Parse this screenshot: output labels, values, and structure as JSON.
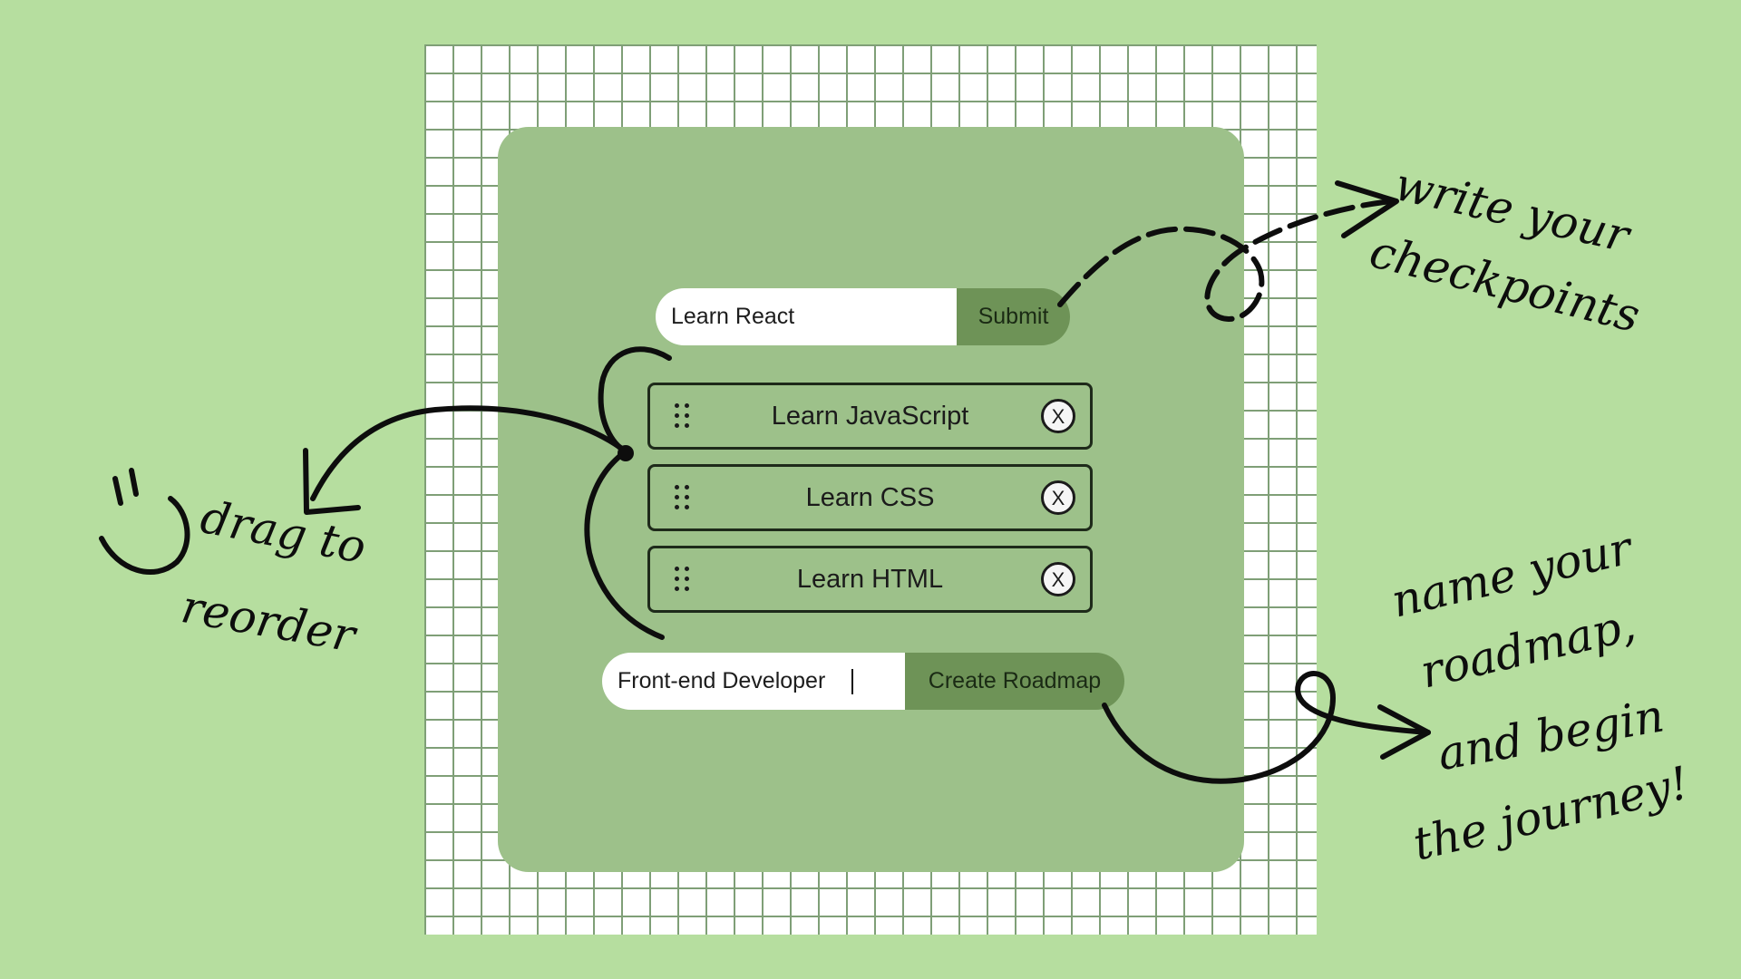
{
  "checkpoint_form": {
    "input_value": "Learn React",
    "submit_label": "Submit"
  },
  "checkpoints": [
    {
      "label": "Learn JavaScript",
      "remove_label": "X"
    },
    {
      "label": "Learn CSS",
      "remove_label": "X"
    },
    {
      "label": "Learn HTML",
      "remove_label": "X"
    }
  ],
  "roadmap_form": {
    "input_value": "Front-end Developer",
    "create_label": "Create Roadmap"
  },
  "annotations": {
    "write_line1": "write your",
    "write_line2": "checkpoints",
    "drag_line1": "drag to",
    "drag_line2": "reorder",
    "name_line1": "name your",
    "name_line2": "roadmap,",
    "name_line3": "and begin",
    "name_line4": "the journey!"
  },
  "colors": {
    "background": "#b6de9f",
    "card": "#9dc18a",
    "button": "#6e9357",
    "grid_line": "#7f9f77"
  },
  "icons": {
    "drag_handle": "drag-handle-icon",
    "remove": "close-icon",
    "arrows": "hand-drawn-arrow-icon",
    "smiley": "smiley-icon"
  }
}
